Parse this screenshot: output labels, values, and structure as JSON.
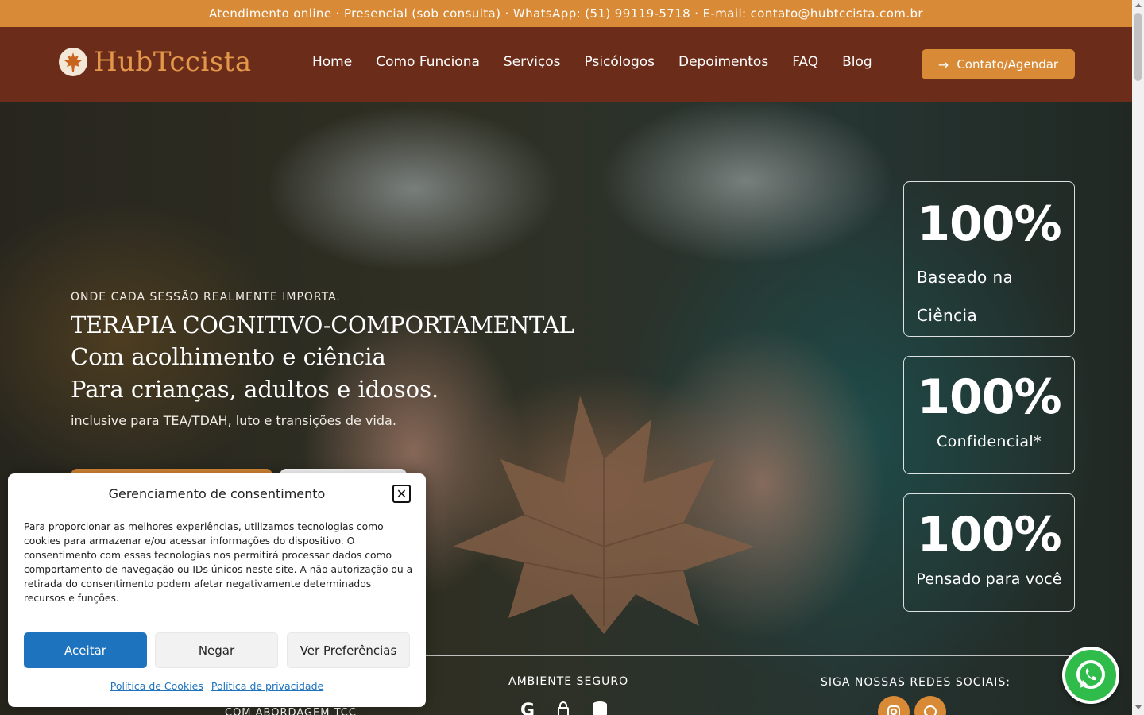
{
  "topbar": {
    "text": "Atendimento online · Presencial (sob consulta) · WhatsApp: (51) 99119-5718 · E-mail: contato@hubtccista.com.br"
  },
  "header": {
    "logo_text": "HubTccista",
    "nav": [
      "Home",
      "Como Funciona",
      "Serviços",
      "Psicólogos",
      "Depoimentos",
      "FAQ",
      "Blog"
    ],
    "cta_label": "Contato/Agendar",
    "cta_icon": "arrow-right-icon"
  },
  "hero": {
    "eyebrow": "ONDE CADA SESSÃO REALMENTE IMPORTA.",
    "line1": "TERAPIA COGNITIVO-COMPORTAMENTAL",
    "line2": "Com acolhimento e ciência",
    "line3": "Para crianças, adultos e idosos.",
    "subtitle": "inclusive para TEA/TDAH, luto e transições de vida.",
    "stats": [
      {
        "value": "100%",
        "label_a": "Baseado na",
        "label_b": "Ciência"
      },
      {
        "value": "100%",
        "label": "Confidencial*"
      },
      {
        "value": "100%",
        "label": "Pensado para você"
      }
    ],
    "safe_title": "AMBIENTE SEGURO",
    "safe_icons": [
      "google-icon",
      "lock-icon",
      "database-icon"
    ],
    "social_title": "SIGA NOSSAS REDES SOCIAIS:",
    "social_icons": [
      "instagram-icon",
      "whatsapp-icon"
    ],
    "bottom_sub": "COM ABORDAGEM TCC"
  },
  "consent": {
    "title": "Gerenciamento de consentimento",
    "body": "Para proporcionar as melhores experiências, utilizamos tecnologias como cookies para armazenar e/ou acessar informações do dispositivo. O consentimento com essas tecnologias nos permitirá processar dados como comportamento de navegação ou IDs únicos neste site. A não autorização ou a retirada do consentimento podem afetar negativamente determinados recursos e funções.",
    "accept": "Aceitar",
    "deny": "Negar",
    "prefs": "Ver Preferências",
    "cookie_policy": "Política de Cookies",
    "privacy_policy": "Política de privacidade"
  },
  "colors": {
    "topbar": "#d98a36",
    "header": "#6b2c1a",
    "accent": "#d98a36",
    "accept_button": "#1e73be",
    "whatsapp": "#2fbc4a"
  }
}
